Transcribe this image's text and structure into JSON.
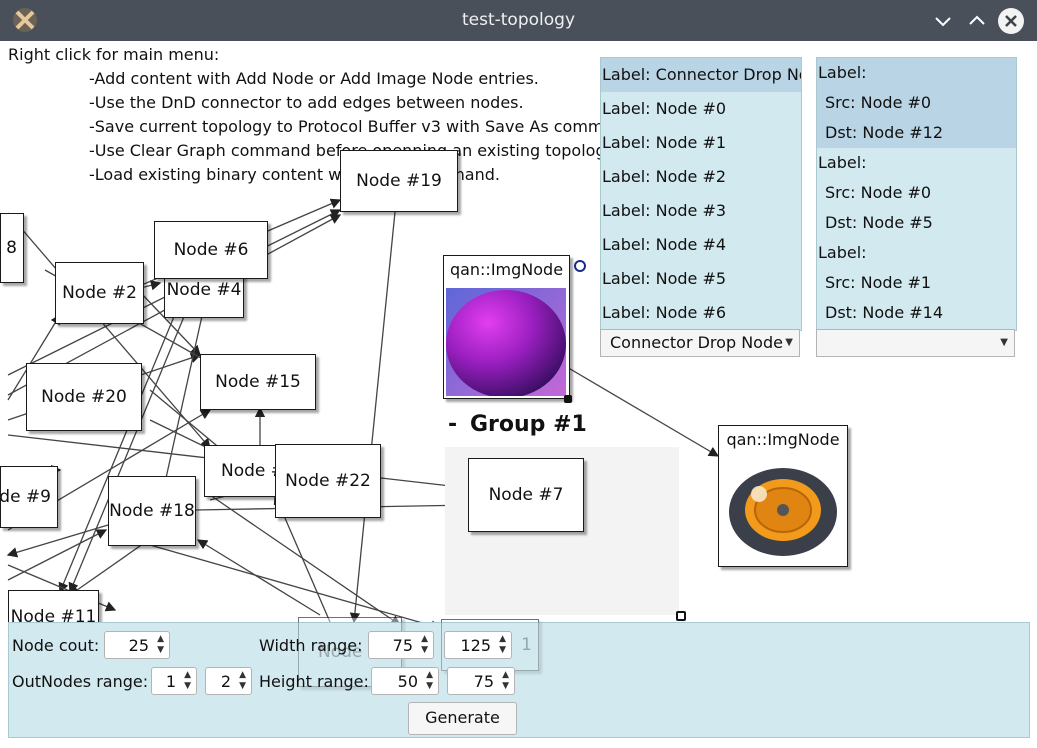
{
  "window": {
    "title": "test-topology"
  },
  "help": {
    "intro": "Right click for main menu:",
    "items": [
      "-Add content with Add Node or Add Image Node entries.",
      "-Use the DnD connector to add edges between nodes.",
      "-Save current topology to Protocol Buffer v3 with Save As command.",
      "-Use Clear Graph command before openning an existing topology file.",
      "-Load existing binary content with Open command."
    ]
  },
  "nodes": {
    "n19": "Node #19",
    "n8": "8",
    "n6": "Node #6",
    "n2": "Node #2",
    "n4": "Node #4",
    "n15": "Node #15",
    "n20": "Node #20",
    "n9": "de #9",
    "n18": "Node #18",
    "nX": "Node #",
    "n22": "Node #22",
    "n7": "Node #7",
    "n11": "Node #11",
    "nh1": "Node #",
    "nh2": "1"
  },
  "img_nodes": {
    "a": "qan::ImgNode",
    "b": "qan::ImgNode"
  },
  "group": {
    "title": "Group #1",
    "collapse": "-"
  },
  "node_list": {
    "items": [
      "Label: Connector Drop Node",
      "Label: Node #0",
      "Label: Node #1",
      "Label: Node #2",
      "Label: Node #3",
      "Label: Node #4",
      "Label: Node #5",
      "Label: Node #6"
    ],
    "combo": "Connector Drop Node"
  },
  "edge_list": {
    "rows": [
      "Label:",
      "Src: Node #0",
      "Dst: Node #12",
      "Label:",
      "Src: Node #0",
      "Dst: Node #5",
      "Label:",
      "Src: Node #1",
      "Dst: Node #14"
    ],
    "combo": ""
  },
  "controls": {
    "node_count_label": "Node cout:",
    "node_count": "25",
    "width_label": "Width range:",
    "width_min": "75",
    "width_max": "125",
    "outnodes_label": "OutNodes range:",
    "out_min": "1",
    "out_max": "2",
    "height_label": "Height range:",
    "height_min": "50",
    "height_max": "75",
    "generate": "Generate"
  }
}
